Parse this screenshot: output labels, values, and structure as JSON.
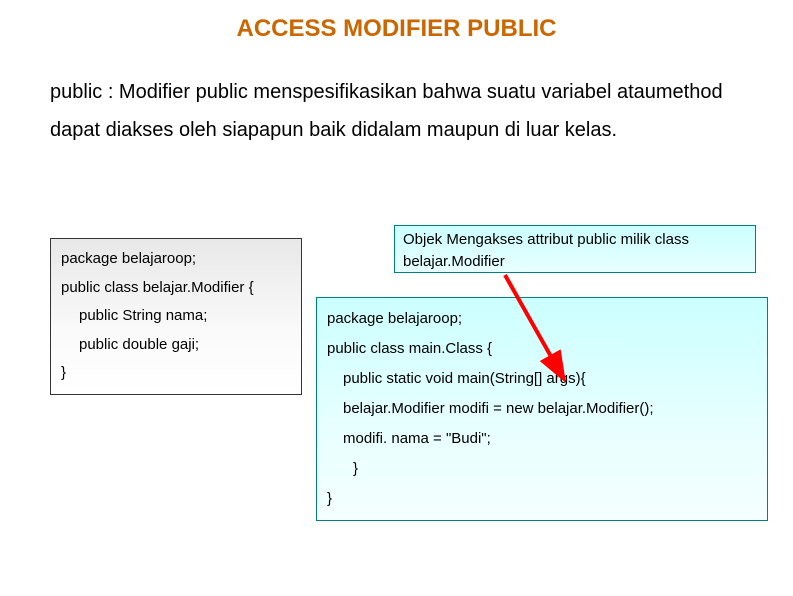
{
  "title": "ACCESS MODIFIER PUBLIC",
  "description": "public : Modifier public menspesifikasikan bahwa suatu variabel ataumethod dapat diakses oleh siapapun baik didalam maupun di luar kelas.",
  "callout": "Objek Mengakses attribut public milik class belajar.Modifier",
  "code1": {
    "l1": "package belajaroop;",
    "l2": "public class belajar.Modifier {",
    "l3": "public String nama;",
    "l4": "public double gaji;",
    "l5": "}"
  },
  "code2": {
    "l1": "package belajaroop;",
    "l2": "public class main.Class {",
    "l3": "public static void main(String[] args){",
    "l4": "belajar.Modifier modifi = new belajar.Modifier();",
    "l5": "modifi. nama = \"Budi\";",
    "l6": "}",
    "l7": "}"
  }
}
